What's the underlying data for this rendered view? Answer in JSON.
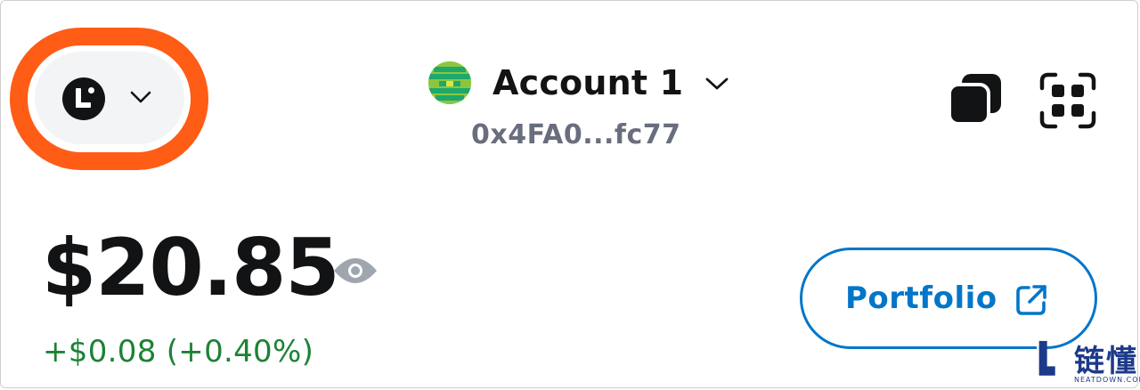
{
  "network": {
    "icon": "linea-network-icon",
    "highlight_color": "#ff5c16",
    "chevron": "chevron-down-icon"
  },
  "account": {
    "name": "Account 1",
    "address": "0x4FA0...fc77",
    "avatar": "identicon-avatar",
    "chevron": "chevron-down-icon"
  },
  "actions": {
    "copy_icon": "copy-icon",
    "scan_icon": "qr-scan-icon"
  },
  "balance": {
    "amount": "$20.85",
    "visibility_icon": "eye-icon",
    "change": "+$0.08 (+0.40%)",
    "change_color": "#1c8234"
  },
  "portfolio": {
    "label": "Portfolio",
    "icon": "external-link-icon",
    "accent": "#0376c9"
  },
  "watermark": {
    "chinese": "链懂",
    "english": "NEATDOWN.COM"
  }
}
